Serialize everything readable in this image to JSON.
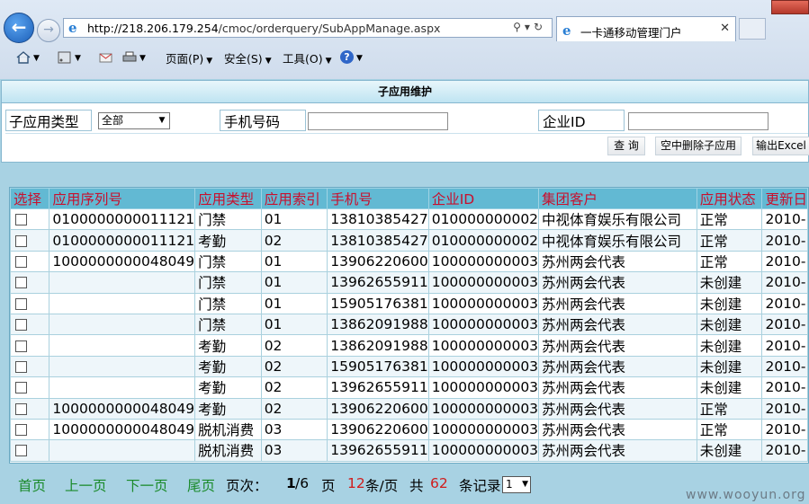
{
  "browser": {
    "url_host": "http://218.206.179.254",
    "url_path": "/cmoc/orderquery/SubAppManage.aspx",
    "tab_title": "一卡通移动管理门户",
    "tab_close": "✕",
    "menu": {
      "page": "页面(P)",
      "safety": "安全(S)",
      "tools": "工具(O)",
      "help": "?"
    }
  },
  "panel": {
    "title": "子应用维护",
    "filters": {
      "app_type_label": "子应用类型",
      "app_type_value": "全部",
      "phone_label": "手机号码",
      "phone_value": "",
      "company_label": "企业ID",
      "company_value": ""
    },
    "buttons": {
      "query": "查 询",
      "delete": "空中删除子应用",
      "export": "输出Excel"
    }
  },
  "grid": {
    "headers": [
      "选择",
      "应用序列号",
      "应用类型",
      "应用索引",
      "手机号",
      "企业ID",
      "集团客户",
      "应用状态",
      "更新日"
    ],
    "rows": [
      [
        "",
        "0100000000011121",
        "门禁",
        "01",
        "13810385427",
        "010000000002",
        "中视体育娱乐有限公司",
        "正常",
        "2010-"
      ],
      [
        "",
        "0100000000011121",
        "考勤",
        "02",
        "13810385427",
        "010000000002",
        "中视体育娱乐有限公司",
        "正常",
        "2010-"
      ],
      [
        "",
        "1000000000048049",
        "门禁",
        "01",
        "13906220600",
        "100000000003",
        "苏州两会代表",
        "正常",
        "2010-"
      ],
      [
        "",
        "",
        "门禁",
        "01",
        "13962655911",
        "100000000003",
        "苏州两会代表",
        "未创建",
        "2010-"
      ],
      [
        "",
        "",
        "门禁",
        "01",
        "15905176381",
        "100000000003",
        "苏州两会代表",
        "未创建",
        "2010-"
      ],
      [
        "",
        "",
        "门禁",
        "01",
        "13862091988",
        "100000000003",
        "苏州两会代表",
        "未创建",
        "2010-"
      ],
      [
        "",
        "",
        "考勤",
        "02",
        "13862091988",
        "100000000003",
        "苏州两会代表",
        "未创建",
        "2010-"
      ],
      [
        "",
        "",
        "考勤",
        "02",
        "15905176381",
        "100000000003",
        "苏州两会代表",
        "未创建",
        "2010-"
      ],
      [
        "",
        "",
        "考勤",
        "02",
        "13962655911",
        "100000000003",
        "苏州两会代表",
        "未创建",
        "2010-"
      ],
      [
        "",
        "1000000000048049",
        "考勤",
        "02",
        "13906220600",
        "100000000003",
        "苏州两会代表",
        "正常",
        "2010-"
      ],
      [
        "",
        "1000000000048049",
        "脱机消费",
        "03",
        "13906220600",
        "100000000003",
        "苏州两会代表",
        "正常",
        "2010-"
      ],
      [
        "",
        "",
        "脱机消费",
        "03",
        "13962655911",
        "100000000003",
        "苏州两会代表",
        "未创建",
        "2010-"
      ]
    ]
  },
  "pager": {
    "first": "首页",
    "prev": "上一页",
    "next": "下一页",
    "last": "尾页",
    "page_label": "页次：",
    "current": "1",
    "total": "/6",
    "page_unit": "页",
    "per_page": "12",
    "per_page_unit": "条/页",
    "total_label": "共",
    "total_records": "62",
    "records_unit": "条记录",
    "jump_value": "1"
  },
  "watermark": "www.wooyun.org",
  "colors": {
    "header_bg": "#62b9d3",
    "header_text": "#c8102e",
    "pager_link": "#1a8a2a",
    "pager_count": "#d01c1c"
  }
}
